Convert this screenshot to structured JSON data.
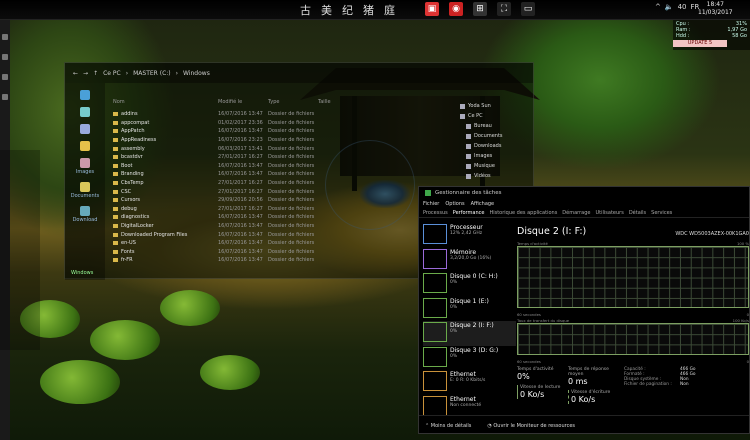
{
  "topbar": {
    "glyphs": [
      "古",
      "美",
      "纪",
      "猪",
      "庭"
    ],
    "clock_time": "18:47",
    "clock_date": "11/03/2017",
    "lang": "FR",
    "tray_label": "40",
    "icon_colors": {
      "icon_1": "#d33",
      "icon_2": "#c22",
      "icon_3": "#4a8"
    }
  },
  "stats": [
    {
      "label": "Cpu :",
      "value": "31%"
    },
    {
      "label": "Ram :",
      "value": "1,97 Go"
    },
    {
      "label": "Hdd :",
      "value": "58 Go"
    }
  ],
  "battery": "UPDATE 5",
  "explorer": {
    "breadcrumb": [
      "Ce PC",
      "MASTER (C:)",
      "Windows"
    ],
    "columns": [
      "Nom",
      "Modifié le",
      "Type",
      "Taille"
    ],
    "sidebar": [
      {
        "label": "",
        "color": "#4aa0d8"
      },
      {
        "label": "",
        "color": "#7cc"
      },
      {
        "label": "",
        "color": "#9ad"
      },
      {
        "label": "",
        "color": "#e7c14a"
      },
      {
        "label": "Images",
        "color": "#c9a"
      },
      {
        "label": "Documents",
        "color": "#d9c75a"
      },
      {
        "label": "Download",
        "color": "#6ab"
      }
    ],
    "rows": [
      {
        "name": "addins",
        "date": "16/07/2016 13:47",
        "type": "Dossier de fichiers"
      },
      {
        "name": "appcompat",
        "date": "01/02/2017 23:36",
        "type": "Dossier de fichiers"
      },
      {
        "name": "AppPatch",
        "date": "16/07/2016 13:47",
        "type": "Dossier de fichiers"
      },
      {
        "name": "AppReadiness",
        "date": "16/07/2016 23:23",
        "type": "Dossier de fichiers"
      },
      {
        "name": "assembly",
        "date": "06/03/2017 13:41",
        "type": "Dossier de fichiers"
      },
      {
        "name": "bcastdvr",
        "date": "27/01/2017 16:27",
        "type": "Dossier de fichiers"
      },
      {
        "name": "Boot",
        "date": "16/07/2016 13:47",
        "type": "Dossier de fichiers"
      },
      {
        "name": "Branding",
        "date": "16/07/2016 13:47",
        "type": "Dossier de fichiers"
      },
      {
        "name": "CbsTemp",
        "date": "27/01/2017 16:27",
        "type": "Dossier de fichiers"
      },
      {
        "name": "CSC",
        "date": "27/01/2017 16:27",
        "type": "Dossier de fichiers"
      },
      {
        "name": "Cursors",
        "date": "29/09/2016 20:56",
        "type": "Dossier de fichiers"
      },
      {
        "name": "debug",
        "date": "27/01/2017 16:27",
        "type": "Dossier de fichiers"
      },
      {
        "name": "diagnostics",
        "date": "16/07/2016 13:47",
        "type": "Dossier de fichiers"
      },
      {
        "name": "DigitalLocker",
        "date": "16/07/2016 13:47",
        "type": "Dossier de fichiers"
      },
      {
        "name": "Downloaded Program Files",
        "date": "16/07/2016 13:47",
        "type": "Dossier de fichiers"
      },
      {
        "name": "en-US",
        "date": "16/07/2016 13:47",
        "type": "Dossier de fichiers"
      },
      {
        "name": "Fonts",
        "date": "16/07/2016 13:47",
        "type": "Dossier de fichiers"
      },
      {
        "name": "fr-FR",
        "date": "16/07/2016 13:47",
        "type": "Dossier de fichiers"
      }
    ],
    "nav": [
      "Yoda Sun",
      "Ce PC",
      "Bureau",
      "Documents",
      "Downloads",
      "Images",
      "Musique",
      "Vidéos"
    ],
    "status": "Windows"
  },
  "taskmgr": {
    "title": "Gestionnaire des tâches",
    "menu": [
      "Fichier",
      "Options",
      "Affichage"
    ],
    "tabs": [
      "Processus",
      "Performance",
      "Historique des applications",
      "Démarrage",
      "Utilisateurs",
      "Détails",
      "Services"
    ],
    "active_tab": "Performance",
    "side": [
      {
        "name": "Processeur",
        "detail": "12% 2,42 GHz",
        "color": "#5a8fd8"
      },
      {
        "name": "Mémoire",
        "detail": "3,2/20,0 Go (16%)",
        "color": "#9a6ad8"
      },
      {
        "name": "Disque 0 (C: H:)",
        "detail": "0%",
        "color": "#6aaa4a"
      },
      {
        "name": "Disque 1 (E:)",
        "detail": "0%",
        "color": "#6aaa4a"
      },
      {
        "name": "Disque 2 (I: F:)",
        "detail": "0%",
        "color": "#6aaa4a"
      },
      {
        "name": "Disque 3 (D: G:)",
        "detail": "0%",
        "color": "#6aaa4a"
      },
      {
        "name": "Ethernet",
        "detail": "E: 0 R: 0 Kbits/s",
        "color": "#c8913a"
      },
      {
        "name": "Ethernet",
        "detail": "Non connecté",
        "color": "#c8913a"
      }
    ],
    "heading": "Disque 2 (I: F:)",
    "model": "WDC WD5003AZEX-00K1GA0",
    "graph1_label": "Temps d'activité",
    "graph1_max": "100 %",
    "graph_seconds": "60 secondes",
    "graph_zero": "0",
    "graph2_label": "Taux de transfert du disque",
    "graph2_max": "100 Ko/s",
    "active_time_label": "Temps d'activité",
    "active_time": "0%",
    "response_label": "Temps de réponse moyen",
    "response": "0 ms",
    "read_label": "Vitesse de lecture",
    "read": "0 Ko/s",
    "write_label": "Vitesse d'écriture",
    "write": "0 Ko/s",
    "props": [
      {
        "k": "Capacité :",
        "v": "466 Go"
      },
      {
        "k": "Formaté :",
        "v": "466 Go"
      },
      {
        "k": "Disque système :",
        "v": "Non"
      },
      {
        "k": "Fichier de pagination :",
        "v": "Non"
      }
    ],
    "less_details": "Moins de détails",
    "open_monitor": "Ouvrir le Moniteur de ressources"
  }
}
